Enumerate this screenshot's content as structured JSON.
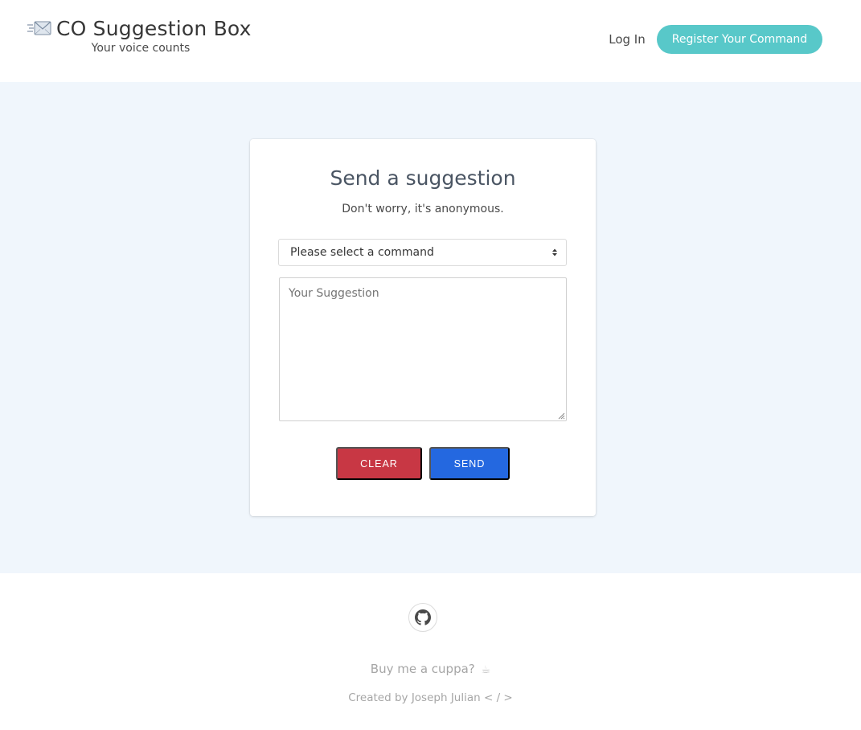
{
  "header": {
    "brand_icon": "envelope-icon",
    "title": "CO Suggestion Box",
    "tagline": "Your voice counts",
    "login_label": "Log In",
    "register_label": "Register Your Command"
  },
  "form": {
    "title": "Send a suggestion",
    "subtitle": "Don't worry, it's anonymous.",
    "command_select": {
      "selected": "Please select a command"
    },
    "suggestion": {
      "value": "",
      "placeholder": "Your Suggestion"
    },
    "clear_label": "CLEAR",
    "send_label": "SEND"
  },
  "footer": {
    "github_icon": "github-icon",
    "cuppa_label": "Buy me a cuppa?",
    "cup_glyph": "☕",
    "credit": "Created by Joseph Julian < / >"
  },
  "colors": {
    "accent": "#58c8c9",
    "danger": "#c83744",
    "primary": "#2468e0",
    "page_background": "#f0f6fc"
  }
}
